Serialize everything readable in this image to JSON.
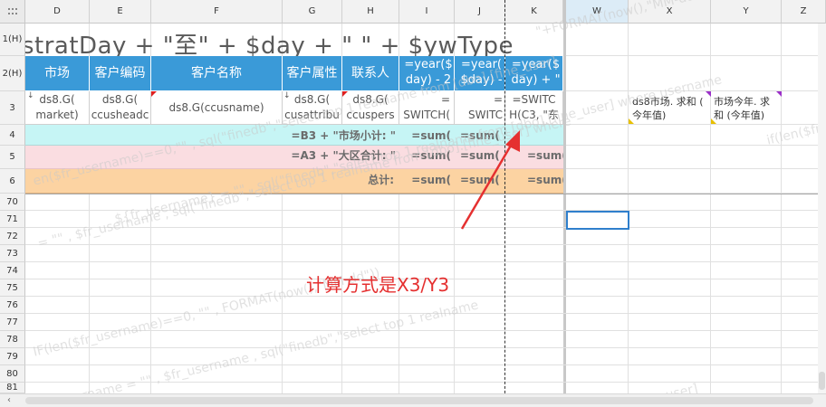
{
  "columns": [
    "D",
    "E",
    "F",
    "G",
    "H",
    "I",
    "J",
    "K",
    "W",
    "X",
    "Y",
    "Z"
  ],
  "corner_icon": "select-all-icon",
  "rows": [
    "1(H)",
    "2(H)",
    "3",
    "4",
    "5",
    "6",
    "70",
    "71",
    "72",
    "73",
    "74",
    "75",
    "76",
    "77",
    "78",
    "79",
    "80",
    "81"
  ],
  "title_formula": "stratDay + \"至\" + $day + \"  \" + $ywType",
  "header_row": {
    "market": "市场",
    "customer_code": "客户编码",
    "customer_name": "客户名称",
    "customer_attr": "客户属性",
    "contact": "联系人",
    "year_prev": "=year($ day) - 2",
    "year_cur": "=year( $day) -",
    "year_k": "=year($ day) + \""
  },
  "data_row": {
    "market": "ds8.G( market)",
    "customer_code": "ds8.G( ccusheadc",
    "customer_name": "ds8.G(ccusname)",
    "customer_attr": "ds8.G( cusattribu",
    "contact": "ds8.G( ccuspers",
    "col_i": "= SWITCH(",
    "col_j": "= SWITC",
    "col_k": "=SWITC H(C3, \"东",
    "col_x": "ds8市场. 求和 ( 今年值)",
    "col_y": "市场今年. 求和 (今年值)"
  },
  "subtotal_row": {
    "label": "=B3 + \"市场小计: \"",
    "i": "=sum(",
    "j": "=sum("
  },
  "region_row": {
    "label": "=A3 + \"大区合计: \"",
    "i": "=sum(",
    "j": "=sum(",
    "k": "=sum("
  },
  "total_row": {
    "label": "总计:",
    "i": "=sum(",
    "j": "=sum(",
    "k": "=sum("
  },
  "annotation": {
    "text": "计算方式是X3/Y3",
    "color": "#e53030"
  },
  "watermark_lines": [
    "${fr_username} = \"\" , sql(\"finedb\",\"select top 1 realname from [dbo].[fine_user] where username",
    "= \"\" , $fr_username , sql(\"finedb\",\"select top 1 realname from [dbo].[fine_user] where",
    "\"+FORMAT(now(),\"MM-dd\"))",
    "en($fr_username)==0,\"\" , sql(\"finedb\",\"select top 1 realname from [dbo].[fine_user]",
    "here username = \"\" , $fr_username , sql(\"finedb\",\"select top 1 realname",
    "if(len($fr",
    "[dbo].[fine_user]",
    "IF(len($fr_username)==0, \"\" , FORMAT(now(),\"MM-dd\"))"
  ],
  "colors": {
    "header_blue": "#3a9ad8",
    "subtotal_cyan": "#c6f5f5",
    "region_pink": "#fadde1",
    "total_orange": "#fcd3a2",
    "selection_blue": "#2f7fcc",
    "arrow_red": "#e53030"
  }
}
